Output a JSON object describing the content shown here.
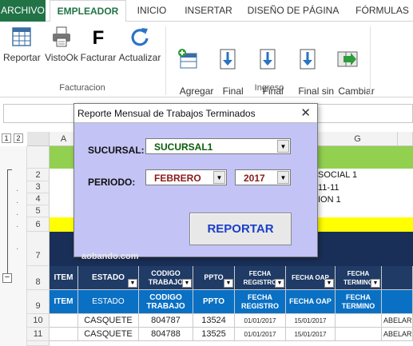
{
  "tabs": [
    {
      "label": "ARCHIVO"
    },
    {
      "label": "EMPLEADOR"
    },
    {
      "label": "INICIO"
    },
    {
      "label": "INSERTAR"
    },
    {
      "label": "DISEÑO DE PÁGINA"
    },
    {
      "label": "FÓRMULAS"
    }
  ],
  "ribbon": {
    "buttons": [
      {
        "label": "Reportar",
        "icon": "table-report-icon"
      },
      {
        "label": "VistoOk",
        "icon": "printer-icon"
      },
      {
        "label": "Facturar",
        "icon": "letter-f-icon"
      },
      {
        "label": "Actualizar",
        "icon": "refresh-icon"
      },
      {
        "label": "Agregar\nFila",
        "icon": "add-row-icon"
      },
      {
        "label": "Final\nIngresos",
        "icon": "download-doc-icon"
      },
      {
        "label": "Final\nProcesos",
        "icon": "download-doc-icon"
      },
      {
        "label": "Final sin\nDocped",
        "icon": "download-doc-icon"
      },
      {
        "label": "Cambiar\nHoja",
        "icon": "switch-sheet-icon"
      }
    ],
    "groups": [
      {
        "label": "Facturacion"
      },
      {
        "label": "Ingreso"
      }
    ]
  },
  "outline_levels": [
    "1",
    "2"
  ],
  "columns": [
    "A",
    "G"
  ],
  "rows": [
    "2",
    "3",
    "4",
    "5",
    "6",
    "7",
    "8",
    "9",
    "10",
    "11"
  ],
  "sheet_text": {
    "g2": "SOCIAL 1",
    "g3": "11-11",
    "g4": "ION 1"
  },
  "table": {
    "header_dark": [
      "ITEM",
      "ESTADO",
      "CODIGO TRABAJO",
      "PPTO",
      "FECHA REGISTRO",
      "FECHA OAP",
      "FECHA TERMINO"
    ],
    "header_blue": [
      "ITEM",
      "ESTADO",
      "CODIGO TRABAJO",
      "PPTO",
      "FECHA REGISTRO",
      "FECHA OAP",
      "FECHA TERMINO"
    ],
    "rows": [
      {
        "item": "",
        "estado": "CASQUETE",
        "codigo": "804787",
        "ppto": "13524",
        "registro": "01/01/2017",
        "oap": "15/01/2017",
        "termino": "",
        "extra": "ABELARD"
      },
      {
        "item": "",
        "estado": "CASQUETE",
        "codigo": "804788",
        "ppto": "13525",
        "registro": "01/01/2017",
        "oap": "15/01/2017",
        "termino": "",
        "extra": "ABELARD"
      }
    ]
  },
  "dialog": {
    "title": "Reporte Mensual de Trabajos Terminados",
    "close": "✕",
    "sucursal_label": "SUCURSAL:",
    "sucursal_value": "SUCURSAL1",
    "periodo_label": "PERIODO:",
    "month_value": "FEBRERO",
    "year_value": "2017",
    "button": "REPORTAR",
    "watermark": "aobando.com"
  },
  "colors": {
    "excel_green": "#217346",
    "dialog_bg": "#c3c3f5",
    "header_dark": "#1f3b66",
    "header_blue": "#0a70c4",
    "row1_green": "#92d050",
    "row6_yellow": "#ffff00",
    "month_red": "#8b1a1a",
    "sucursal_green": "#0a5e0a"
  }
}
